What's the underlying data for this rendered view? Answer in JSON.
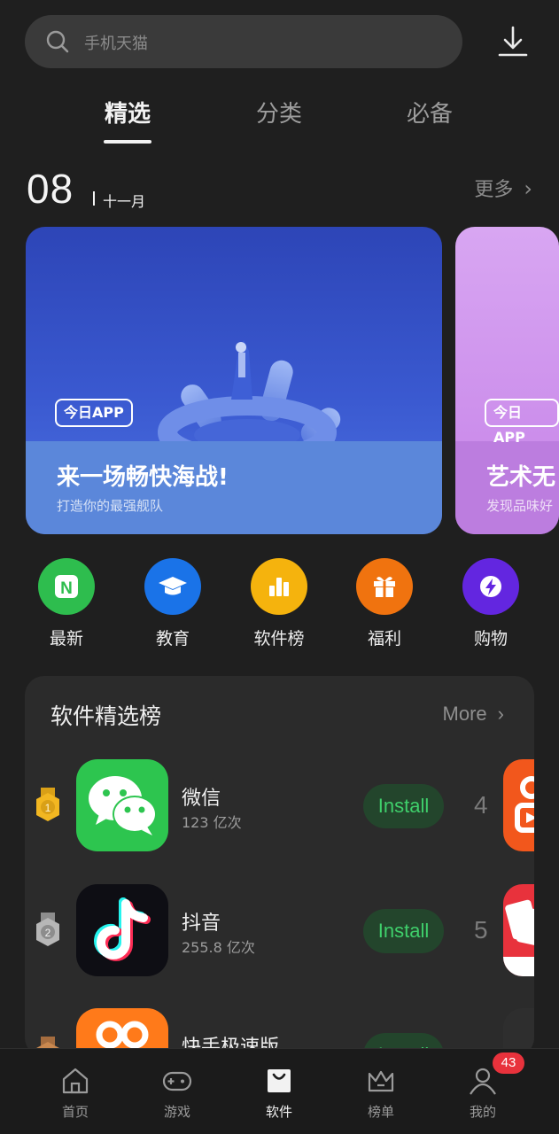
{
  "search": {
    "placeholder": "手机天猫"
  },
  "tabs": [
    {
      "label": "精选",
      "active": true
    },
    {
      "label": "分类",
      "active": false
    },
    {
      "label": "必备",
      "active": false
    }
  ],
  "date": {
    "day": "08",
    "month": "十一月",
    "more_label": "更多"
  },
  "banners": [
    {
      "badge": "今日APP",
      "title": "来一场畅快海战!",
      "subtitle": "打造你的最强舰队"
    },
    {
      "badge": "今日APP",
      "title": "艺术无",
      "subtitle": "发现品味好"
    }
  ],
  "categories": [
    {
      "label": "最新",
      "icon": "new-icon",
      "color": "#2ebd4e"
    },
    {
      "label": "教育",
      "icon": "graduation-cap-icon",
      "color": "#1a73e8"
    },
    {
      "label": "软件榜",
      "icon": "bar-chart-icon",
      "color": "#f5b30d"
    },
    {
      "label": "福利",
      "icon": "gift-icon",
      "color": "#f0730f"
    },
    {
      "label": "购物",
      "icon": "lightning-icon",
      "color": "#6326e0"
    }
  ],
  "ranking": {
    "title": "软件精选榜",
    "more_label": "More",
    "install_label": "Install",
    "apps": [
      {
        "rank": "1",
        "name": "微信",
        "count": "123 亿次",
        "icon": "wechat-icon",
        "next_rank": "4"
      },
      {
        "rank": "2",
        "name": "抖音",
        "count": "255.8 亿次",
        "icon": "douyin-icon",
        "next_rank": "5"
      },
      {
        "rank": "3",
        "name": "快手极速版",
        "count": "",
        "icon": "kuaishou-icon",
        "next_rank": ""
      }
    ]
  },
  "nav": [
    {
      "label": "首页",
      "icon": "home-icon",
      "active": false
    },
    {
      "label": "游戏",
      "icon": "gamepad-icon",
      "active": false
    },
    {
      "label": "软件",
      "icon": "shopping-bag-icon",
      "active": true
    },
    {
      "label": "榜单",
      "icon": "crown-icon",
      "active": false
    },
    {
      "label": "我的",
      "icon": "profile-icon",
      "active": false
    }
  ],
  "profile_badge": "43"
}
